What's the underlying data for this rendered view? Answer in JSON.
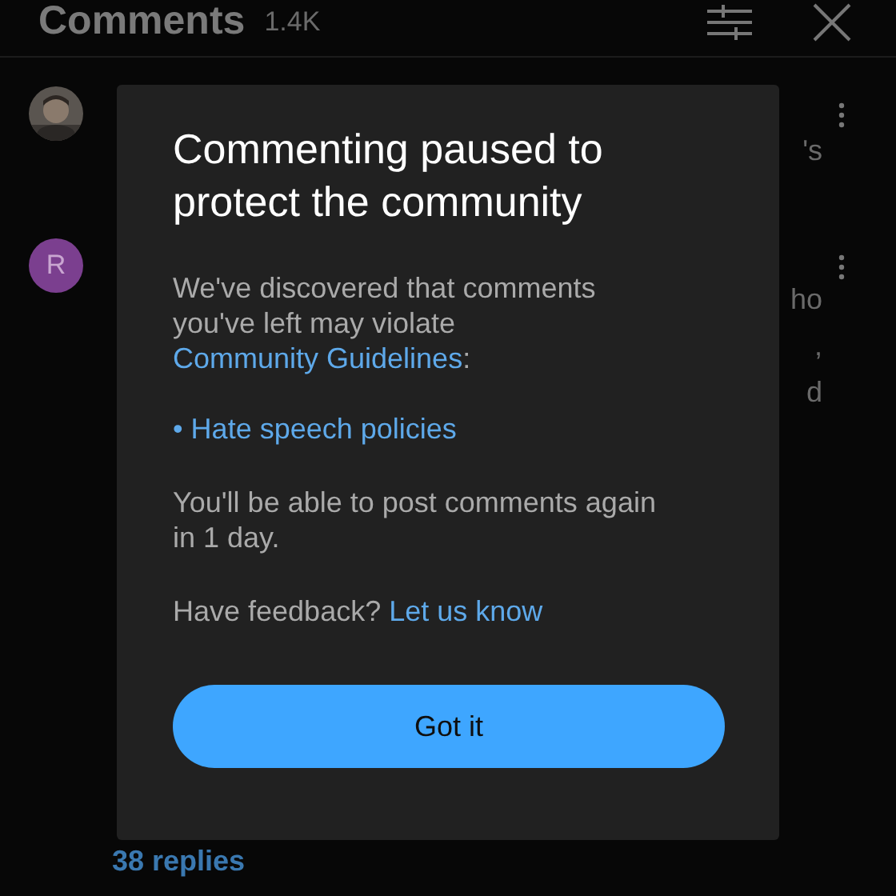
{
  "header": {
    "title": "Comments",
    "count": "1.4K"
  },
  "comments": [
    {
      "avatar": {
        "kind": "picture"
      },
      "fragments": [
        "'s"
      ]
    },
    {
      "avatar": {
        "kind": "letter",
        "letter": "R",
        "color": "#7b3f8f"
      },
      "fragments": [
        "ho",
        ",",
        "d"
      ]
    }
  ],
  "replies_link": "38 replies",
  "dialog": {
    "title": "Commenting paused to protect the community",
    "intro": "We've discovered that comments you've left may violate",
    "intro_link": "Community Guidelines",
    "intro_suffix": ":",
    "policies": [
      "• Hate speech policies"
    ],
    "notice": "You'll be able to post comments again in 1 day.",
    "feedback": "Have feedback?",
    "feedback_link": "Let us know",
    "button": "Got it"
  }
}
